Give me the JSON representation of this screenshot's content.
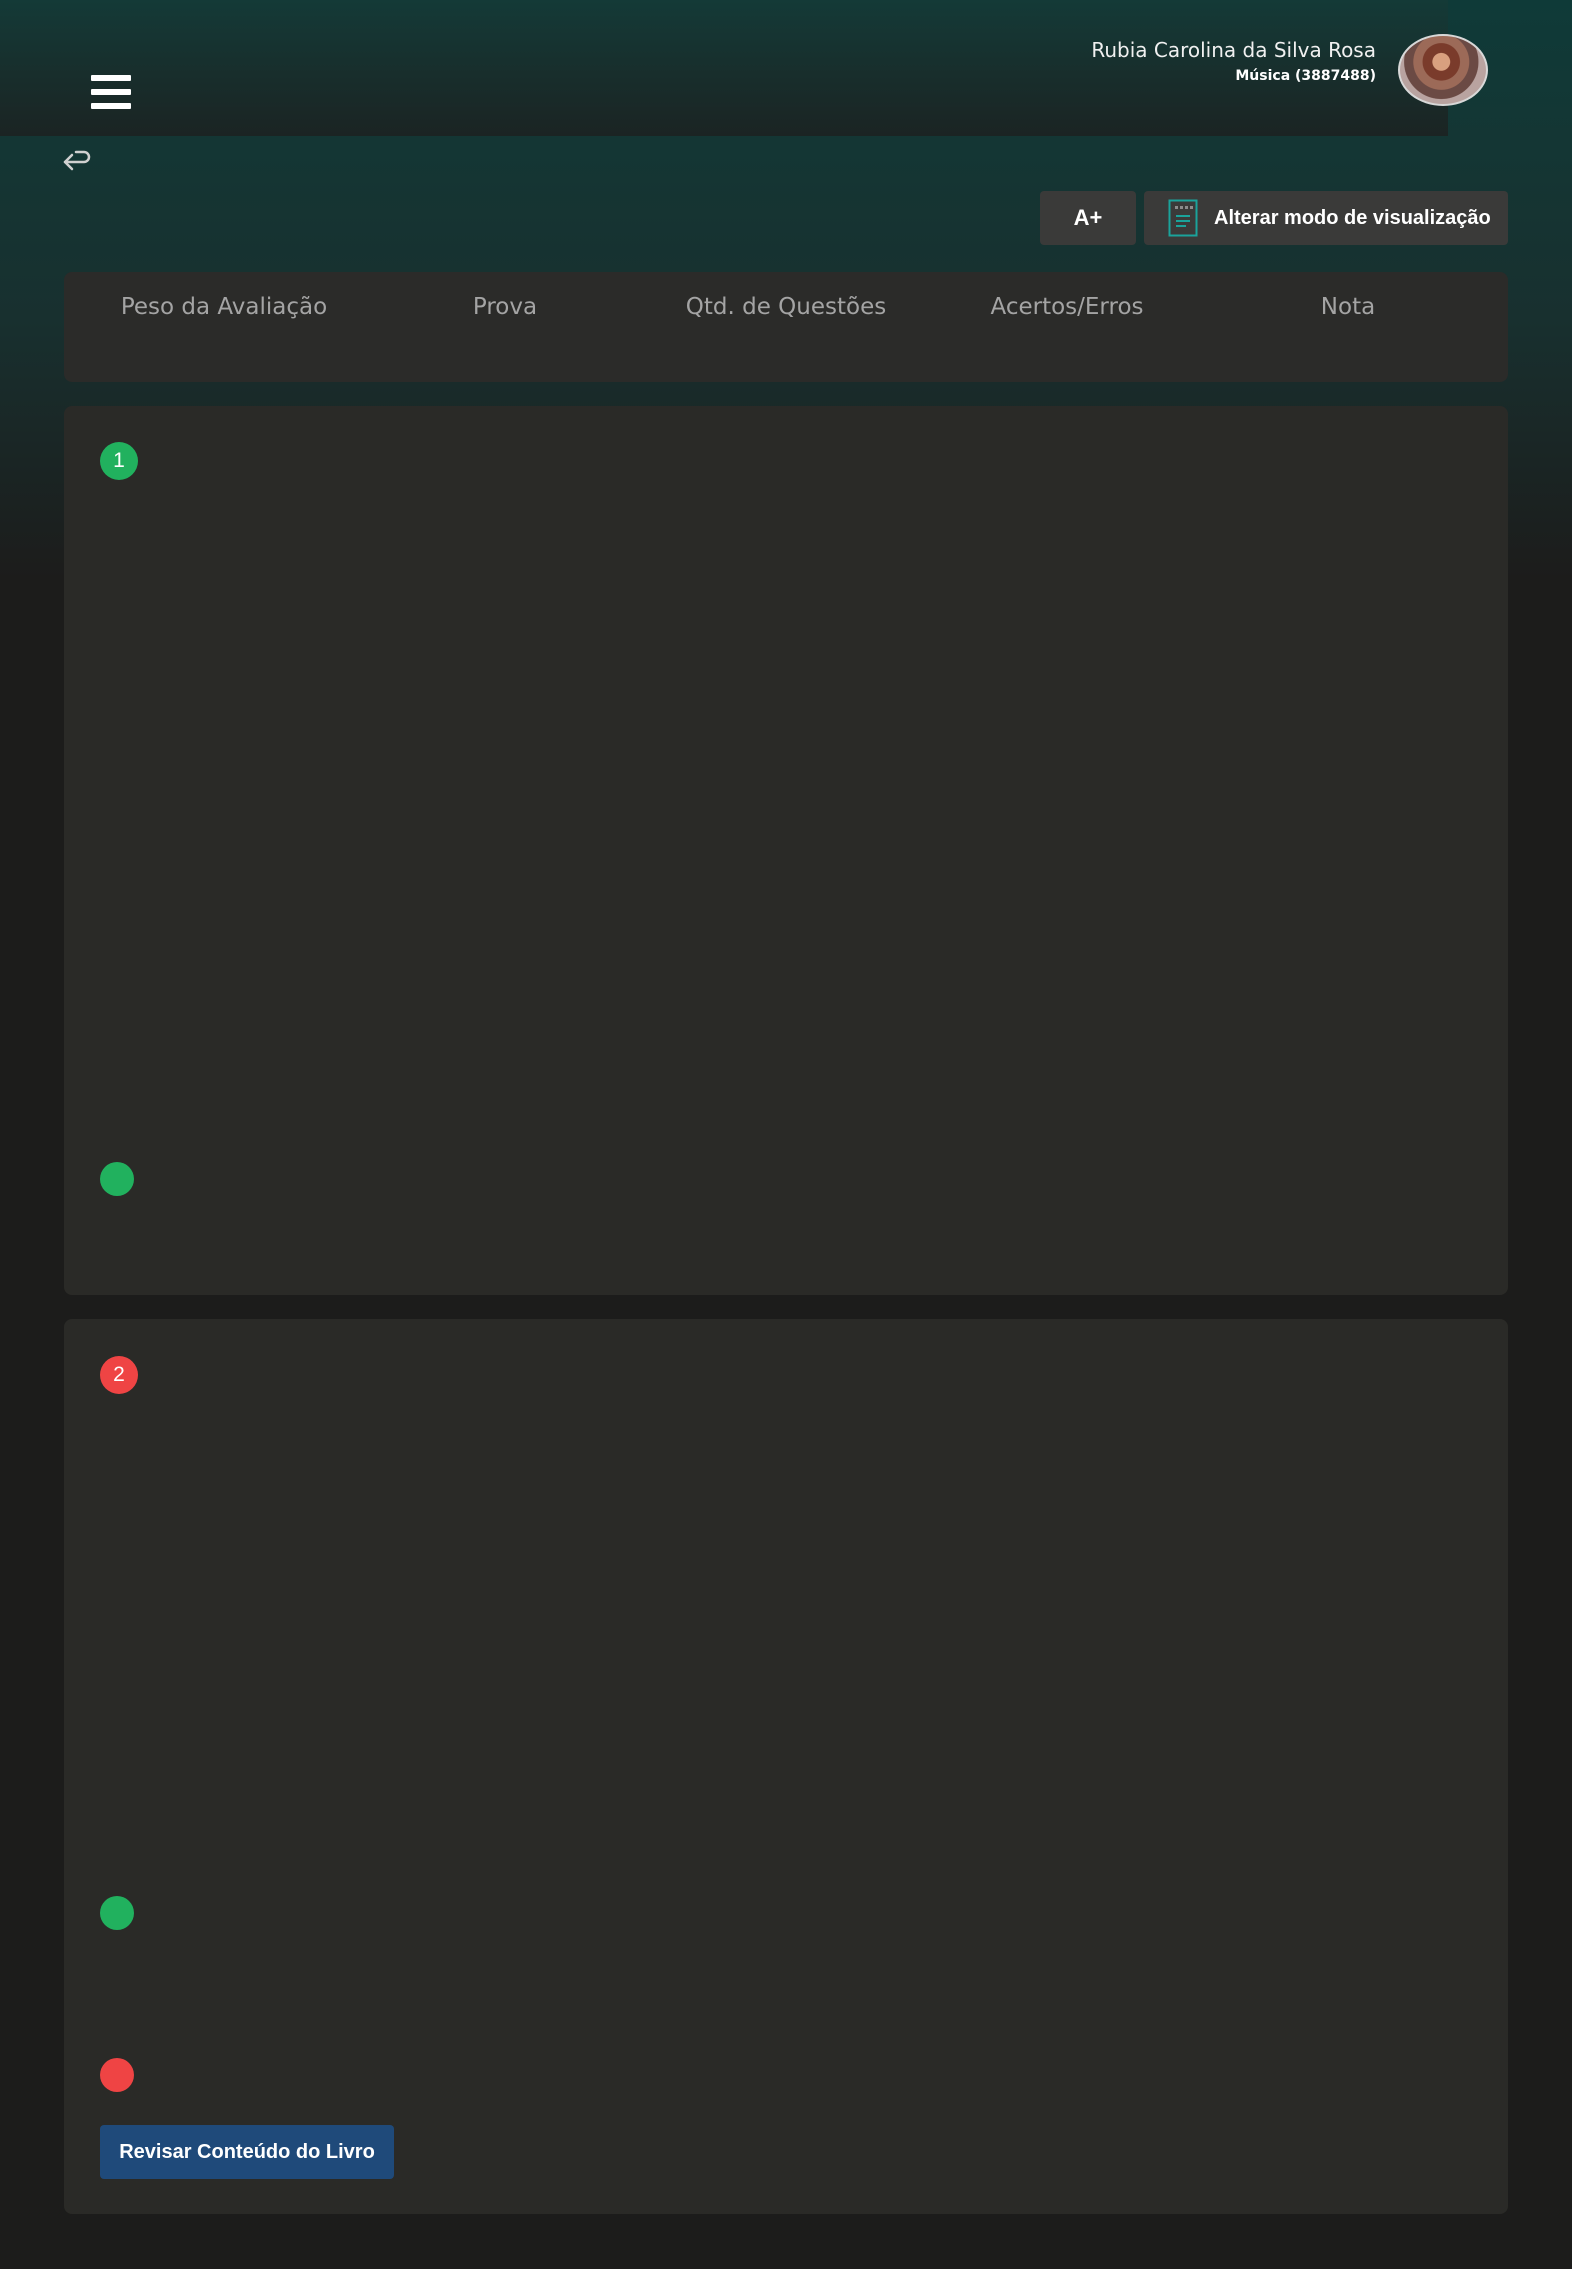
{
  "header": {
    "user_name": "Rubia Carolina da Silva Rosa",
    "user_course": "Música (3887488)",
    "menu_icon": "hamburger-menu-icon",
    "back_icon": "return-arrow-icon"
  },
  "toolbar": {
    "font_increase_label": "A+",
    "view_mode_label": "Alterar modo de visualização",
    "view_mode_icon": "document-icon"
  },
  "summary": {
    "columns": [
      "Peso da Avaliação",
      "Prova",
      "Qtd. de Questões",
      "Acertos/Erros",
      "Nota"
    ]
  },
  "questions": [
    {
      "number": "1",
      "status": "correct"
    },
    {
      "number": "2",
      "status": "incorrect"
    }
  ],
  "actions": {
    "review_label": "Revisar Conteúdo do Livro"
  },
  "colors": {
    "correct": "#21b15e",
    "incorrect": "#ef4444",
    "primary_button": "#1f4a7a",
    "accent": "#1aa39b"
  }
}
